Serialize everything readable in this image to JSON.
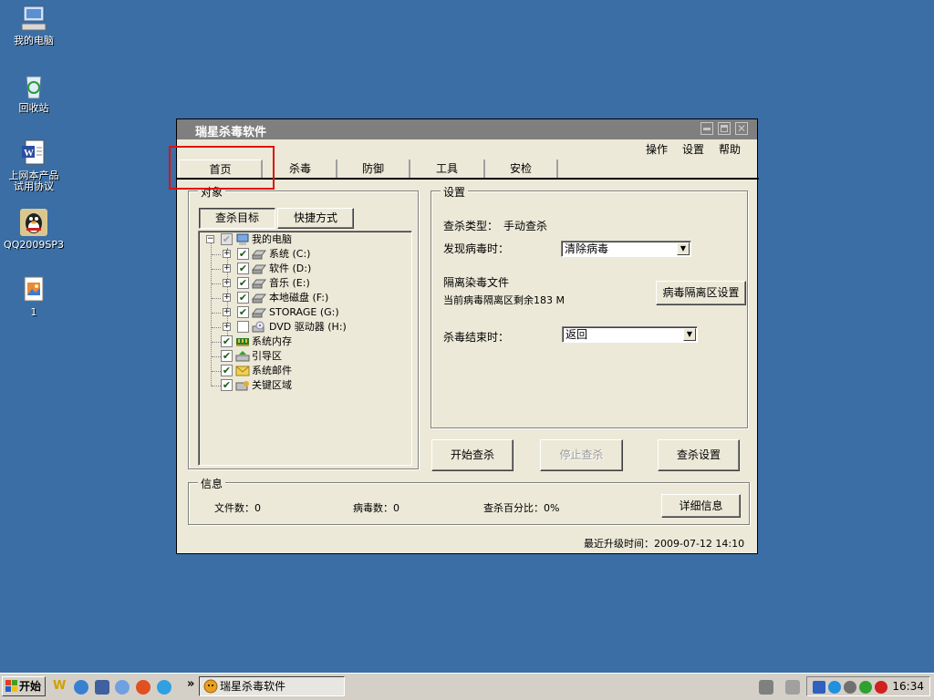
{
  "desktop": {
    "icons": [
      {
        "label": "我的电脑"
      },
      {
        "label": "回收站"
      },
      {
        "label_line1": "上网本产品",
        "label_line2": "试用协议"
      },
      {
        "label": "QQ2009SP3"
      },
      {
        "label": "1"
      }
    ]
  },
  "window": {
    "title": "瑞星杀毒软件",
    "menu": [
      "操作",
      "设置",
      "帮助"
    ],
    "tabs": [
      "首页",
      "杀毒",
      "防御",
      "工具",
      "安检"
    ],
    "target_group": {
      "legend": "对象",
      "buttons": [
        "查杀目标",
        "快捷方式"
      ],
      "tree": [
        {
          "label": "我的电脑",
          "checked": "partial"
        },
        {
          "label": "系统  (C:)",
          "checked": true
        },
        {
          "label": "软件  (D:)",
          "checked": true
        },
        {
          "label": "音乐  (E:)",
          "checked": true
        },
        {
          "label": "本地磁盘  (F:)",
          "checked": true
        },
        {
          "label": "STORAGE  (G:)",
          "checked": true
        },
        {
          "label": "DVD 驱动器  (H:)",
          "checked": false
        },
        {
          "label": "系统内存",
          "checked": true
        },
        {
          "label": "引导区",
          "checked": true
        },
        {
          "label": "系统邮件",
          "checked": true
        },
        {
          "label": "关键区域",
          "checked": true
        }
      ]
    },
    "settings_group": {
      "legend": "设置",
      "scan_type_label": "查杀类型：",
      "scan_type_value": "手动查杀",
      "on_virus_label": "发现病毒时：",
      "on_virus_value": "清除病毒",
      "quarantine_title": "隔离染毒文件",
      "quarantine_remaining": "当前病毒隔离区剩余183 M",
      "quarantine_button": "病毒隔离区设置",
      "on_finish_label": "杀毒结束时：",
      "on_finish_value": "返回"
    },
    "actions": {
      "start": "开始查杀",
      "stop": "停止查杀",
      "settings": "查杀设置"
    },
    "info_group": {
      "legend": "信息",
      "files_label": "文件数：0",
      "viruses_label": "病毒数：0",
      "percent_label": "查杀百分比：0%",
      "details_button": "详细信息"
    },
    "last_update": "最近升级时间：2009-07-12 14:10"
  },
  "taskbar": {
    "start_label": "开始",
    "chevron": "»",
    "task_label": "瑞星杀毒软件",
    "clock": "16:34"
  }
}
